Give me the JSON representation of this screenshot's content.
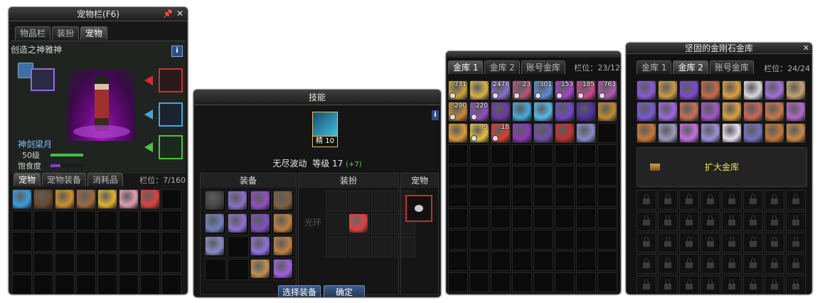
{
  "pet_window": {
    "title": "宠物栏(F6)",
    "tabs": [
      "物品栏",
      "装扮",
      "宠物"
    ],
    "active_tab": 2,
    "overlay_text": "创造之神雅神",
    "info_icon": "i",
    "pet_name": "神剑梁月",
    "level": "50级",
    "hunger_label": "饱食度",
    "bottom_tabs": [
      "宠物",
      "宠物装备",
      "消耗品"
    ],
    "slot_label": "栏位：7/160",
    "items": [
      "slime-blue",
      "chest-dark",
      "cookie",
      "girl-brown",
      "dog-yellow",
      "girl-pink",
      "girl-red"
    ]
  },
  "skill_window": {
    "title": "技能",
    "skill_grade": "精 10",
    "skill_name": "无尽波动",
    "level_text": "等级 17",
    "bonus": "(+7)",
    "info_icon": "i",
    "col_equip": "装备",
    "col_avatar": "装扮",
    "col_pet": "宠物",
    "avatar_placeholder": "光环",
    "select_button": "选择装备",
    "confirm_button": "确定"
  },
  "vault1": {
    "tabs": [
      "金库 1",
      "金库 2",
      "账号金库"
    ],
    "active_tab": 0,
    "slot_label": "栏位：23/12",
    "items": [
      {
        "c": "#c9a23a",
        "q": "731"
      },
      {
        "c": "#d8b14a",
        "q": ""
      },
      {
        "c": "#8a6ec7",
        "q": "2478"
      },
      {
        "c": "#b0587a",
        "q": "23"
      },
      {
        "c": "#5a8ed8",
        "q": "301"
      },
      {
        "c": "#a046c8",
        "q": "153"
      },
      {
        "c": "#c84a8c",
        "q": "185"
      },
      {
        "c": "#b058b8",
        "q": "763"
      },
      {
        "c": "#c98a38",
        "q": "290"
      },
      {
        "c": "#9050c0",
        "q": "220"
      },
      {
        "c": "#6a3aa0",
        "q": ""
      },
      {
        "c": "#48a8d8",
        "q": ""
      },
      {
        "c": "#58b8e8",
        "q": ""
      },
      {
        "c": "#7048c0",
        "q": ""
      },
      {
        "c": "#5030a0",
        "q": ""
      },
      {
        "c": "#c08a30",
        "q": ""
      },
      {
        "c": "#d89a40",
        "q": ""
      },
      {
        "c": "#e8c040",
        "q": "9"
      },
      {
        "c": "#d84030",
        "q": "18"
      },
      {
        "c": "#8a3ab8",
        "q": ""
      },
      {
        "c": "#7050a8",
        "q": ""
      },
      {
        "c": "#c03030",
        "q": ""
      },
      {
        "c": "#8a8ac8",
        "q": ""
      }
    ]
  },
  "vault2": {
    "title": "坚固的金刚石金库",
    "tabs": [
      "金库 1",
      "金库 2",
      "账号金库"
    ],
    "active_tab": 1,
    "slot_label": "栏位：24/24",
    "expand_label": "扩大金库",
    "items": [
      "#8a5ad8",
      "#c99a48",
      "#7a4ad0",
      "#c86a48",
      "#d8a040",
      "#d8d8e0",
      "#a070d8",
      "#c8a070",
      "#7a5ad0",
      "#a068e0",
      "#c87058",
      "#a058c8",
      "#d8a048",
      "#c86858",
      "#c87848",
      "#b068c8",
      "#c87838",
      "#9a9ab8",
      "#c070e0",
      "#9a90d8",
      "#e8e0f0",
      "#7870c0",
      "#c07838",
      "#c88848"
    ]
  }
}
